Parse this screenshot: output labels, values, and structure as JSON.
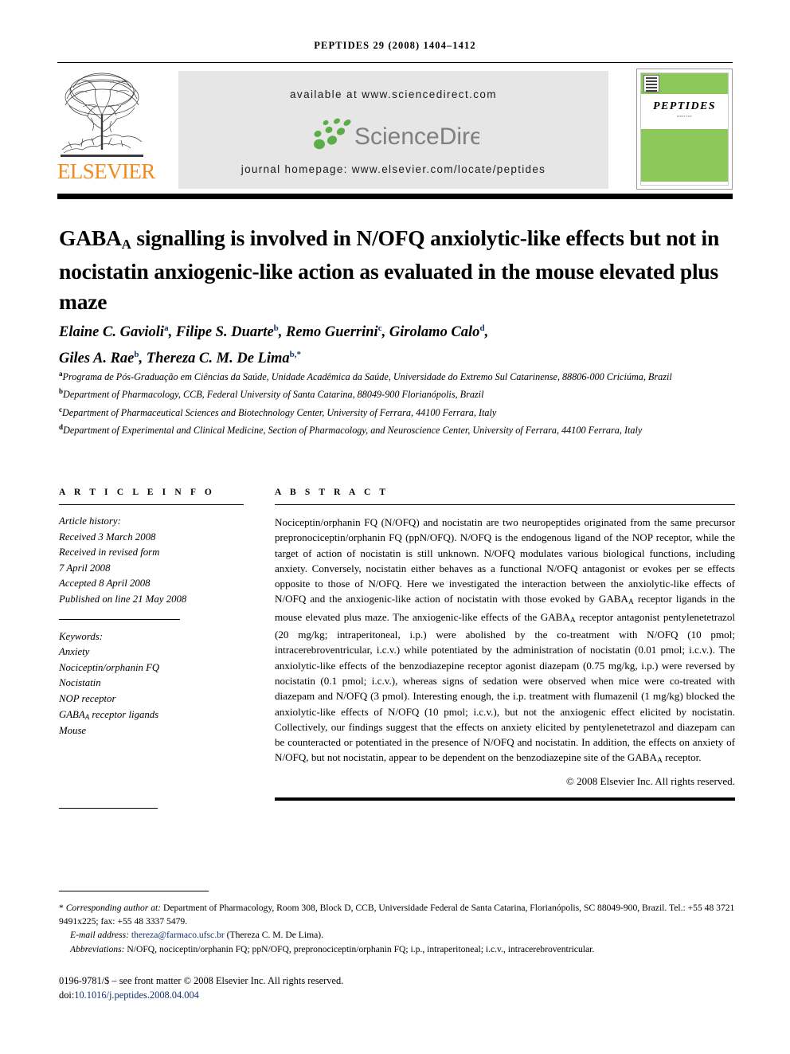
{
  "running_head": "PEPTIDES 29 (2008) 1404–1412",
  "masthead": {
    "publisher": "ELSEVIER",
    "available_at": "available at www.sciencedirect.com",
    "sciencedirect_wordmark": "ScienceDirect",
    "journal_homepage": "journal homepage: www.elsevier.com/locate/peptides",
    "cover": {
      "title": "PEPTIDES",
      "subtitle": "",
      "green": "#8DC85A"
    },
    "elsevier_orange": "#F08A1E",
    "sd_green": "#5CAD47",
    "sd_gray": "#7F7F7F"
  },
  "article": {
    "title_part1": "GABA",
    "title_sub": "A",
    "title_part2": " signalling is involved in N/OFQ anxiolytic-like effects but not in nocistatin anxiogenic-like action as evaluated in the mouse elevated plus maze",
    "authors": [
      {
        "name": "Elaine C. Gavioli",
        "marks": "a"
      },
      {
        "name": "Filipe S. Duarte",
        "marks": "b"
      },
      {
        "name": "Remo Guerrini",
        "marks": "c"
      },
      {
        "name": "Girolamo Calo",
        "marks": "d"
      },
      {
        "name": "Giles A. Rae",
        "marks": "b"
      },
      {
        "name": "Thereza C. M. De Lima",
        "marks": "b,*"
      }
    ],
    "affiliations": [
      {
        "mark": "a",
        "text": "Programa de Pós-Graduação em Ciências da Saúde, Unidade Acadêmica da Saúde, Universidade do Extremo Sul Catarinense, 88806-000 Criciúma, Brazil"
      },
      {
        "mark": "b",
        "text": "Department of Pharmacology, CCB, Federal University of Santa Catarina, 88049-900 Florianópolis, Brazil"
      },
      {
        "mark": "c",
        "text": "Department of Pharmaceutical Sciences and Biotechnology Center, University of Ferrara, 44100 Ferrara, Italy"
      },
      {
        "mark": "d",
        "text": "Department of Experimental and Clinical Medicine, Section of Pharmacology, and Neuroscience Center, University of Ferrara, 44100 Ferrara, Italy"
      }
    ]
  },
  "article_info": {
    "heading": "A R T I C L E  I N F O",
    "history_label": "Article history:",
    "history": [
      "Received 3 March 2008",
      "Received in revised form",
      "7 April 2008",
      "Accepted 8 April 2008",
      "Published on line 21 May 2008"
    ],
    "keywords_label": "Keywords:",
    "keywords": [
      "Anxiety",
      "Nociceptin/orphanin FQ",
      "Nocistatin",
      "NOP receptor",
      "GABA_A receptor ligands",
      "Mouse"
    ]
  },
  "abstract": {
    "heading": "A B S T R A C T",
    "p1": "Nociceptin/orphanin FQ (N/OFQ) and nocistatin are two neuropeptides originated from the same precursor prepronociceptin/orphanin FQ (ppN/OFQ). N/OFQ is the endogenous ligand of the NOP receptor, while the target of action of nocistatin is still unknown. N/OFQ modulates various biological functions, including anxiety. Conversely, nocistatin either behaves as a functional N/OFQ antagonist or evokes per se effects opposite to those of N/OFQ. Here we investigated the interaction between the anxiolytic-like effects of N/OFQ and the anxiogenic-like action of nocistatin with those evoked by GABA",
    "p2": " receptor ligands in the mouse elevated plus maze. The anxiogenic-like effects of the GABA",
    "p3": " receptor antagonist pentylenetetrazol (20 mg/kg; intraperitoneal, i.p.) were abolished by the co-treatment with N/OFQ (10 pmol; intracerebroventricular, i.c.v.) while potentiated by the administration of nocistatin (0.01 pmol; i.c.v.). The anxiolytic-like effects of the benzodiazepine receptor agonist diazepam (0.75 mg/kg, i.p.) were reversed by nocistatin (0.1 pmol; i.c.v.), whereas signs of sedation were observed when mice were co-treated with diazepam and N/OFQ (3 pmol). Interesting enough, the i.p. treatment with flumazenil (1 mg/kg) blocked the anxiolytic-like effects of N/OFQ (10 pmol; i.c.v.), but not the anxiogenic effect elicited by nocistatin. Collectively, our findings suggest that the effects on anxiety elicited by pentylenetetrazol and diazepam can be counteracted or potentiated in the presence of N/OFQ and nocistatin. In addition, the effects on anxiety of N/OFQ, but not nocistatin, appear to be dependent on the benzodiazepine site of the GABA",
    "p4": " receptor.",
    "sub_a": "A",
    "copyright": "© 2008 Elsevier Inc. All rights reserved."
  },
  "footer": {
    "corresponding_label": "Corresponding author at:",
    "corresponding_text": " Department of Pharmacology, Room 308, Block D, CCB, Universidade Federal de Santa Catarina, Florianópolis, SC 88049-900, Brazil. Tel.: +55 48 3721 9491x225; fax: +55 48 3337 5479.",
    "email_label": "E-mail address:",
    "email": "thereza@farmaco.ufsc.br",
    "email_suffix": " (Thereza C. M. De Lima).",
    "abbrev_label": "Abbreviations:",
    "abbrev_text": " N/OFQ, nociceptin/orphanin FQ; ppN/OFQ, prepronociceptin/orphanin FQ; i.p., intraperitoneal; i.c.v., intracerebroventricular.",
    "issn_line": "0196-9781/$ – see front matter © 2008 Elsevier Inc. All rights reserved.",
    "doi_label": "doi:",
    "doi": "10.1016/j.peptides.2008.04.004"
  }
}
